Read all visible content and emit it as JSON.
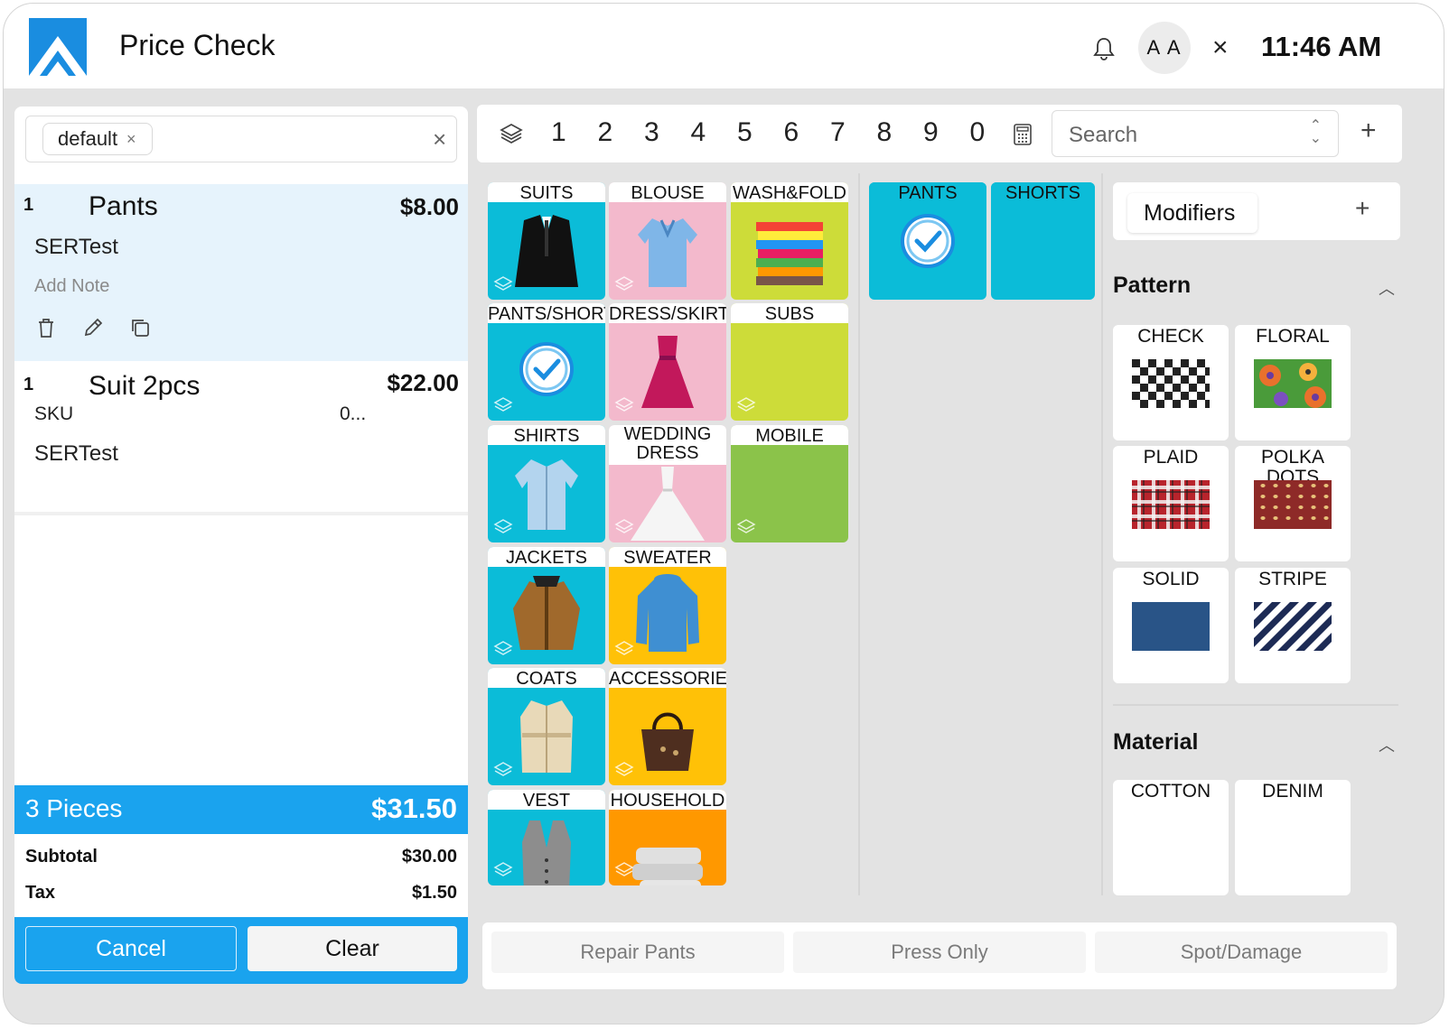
{
  "header": {
    "title": "Price Check",
    "avatar_initials": "A A",
    "time": "11:46 AM"
  },
  "ticket": {
    "tag": "default",
    "items": [
      {
        "qty": "1",
        "name": "Pants",
        "price": "$8.00",
        "line1": "SERTest",
        "note_placeholder": "Add Note"
      },
      {
        "qty": "1",
        "name": "Suit 2pcs",
        "price": "$22.00",
        "sku_label": "SKU",
        "sku_value": "0...",
        "line1": "SERTest"
      }
    ],
    "pieces": "3 Pieces",
    "total": "$31.50",
    "subtotal_label": "Subtotal",
    "subtotal": "$30.00",
    "tax_label": "Tax",
    "tax": "$1.50",
    "cancel_label": "Cancel",
    "clear_label": "Clear"
  },
  "numbar": {
    "digits": [
      "1",
      "2",
      "3",
      "4",
      "5",
      "6",
      "7",
      "8",
      "9",
      "0"
    ],
    "search_placeholder": "Search"
  },
  "categories": [
    {
      "label": "SUITS",
      "color": "#0bbcd8"
    },
    {
      "label": "BLOUSE",
      "color": "#f3b9cc"
    },
    {
      "label": "WASH&FOLD",
      "color": "#cddc39"
    },
    {
      "label": "PANTS/SHORTS",
      "color": "#0bbcd8"
    },
    {
      "label": "DRESS/SKIRT",
      "color": "#f3b9cc"
    },
    {
      "label": "SUBS",
      "color": "#cddc39"
    },
    {
      "label": "SHIRTS",
      "color": "#0bbcd8"
    },
    {
      "label": "WEDDING DRESS",
      "color": "#f3b9cc"
    },
    {
      "label": "MOBILE",
      "color": "#8bc34a"
    },
    {
      "label": "JACKETS",
      "color": "#0bbcd8"
    },
    {
      "label": "SWEATER",
      "color": "#ffc107"
    },
    {
      "label": "COATS",
      "color": "#0bbcd8"
    },
    {
      "label": "ACCESSORIES",
      "color": "#ffc107"
    },
    {
      "label": "VEST",
      "color": "#0bbcd8"
    },
    {
      "label": "HOUSEHOLD",
      "color": "#ff9800"
    }
  ],
  "items": [
    {
      "label": "PANTS",
      "color": "#0bbcd8"
    },
    {
      "label": "SHORTS",
      "color": "#0bbcd8"
    }
  ],
  "modifiers": {
    "chip_label": "Modifiers",
    "pattern_title": "Pattern",
    "patterns": [
      "CHECK",
      "FLORAL",
      "PLAID",
      "POLKA DOTS",
      "SOLID",
      "STRIPE"
    ],
    "material_title": "Material",
    "materials": [
      "COTTON",
      "DENIM"
    ]
  },
  "quick_buttons": [
    "Repair Pants",
    "Press Only",
    "Spot/Damage"
  ],
  "colors": {
    "accent": "#1aa3ee",
    "selected_row": "#e6f3fc",
    "tile_teal": "#0bbcd8",
    "tile_pink": "#f3b9cc",
    "tile_lime": "#cddc39",
    "tile_green": "#8bc34a",
    "tile_yellow": "#ffc107",
    "tile_orange": "#ff9800"
  }
}
